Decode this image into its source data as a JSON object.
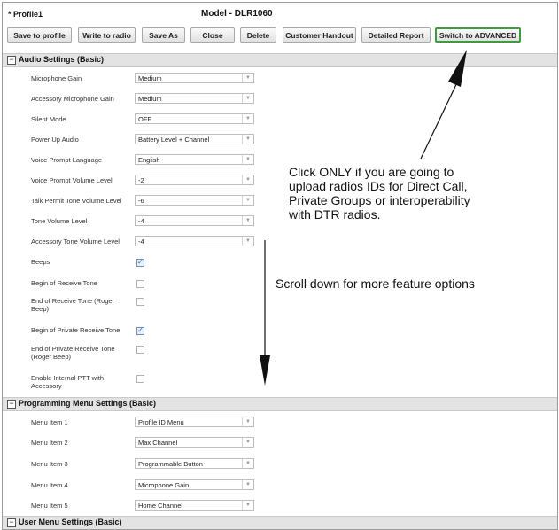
{
  "window": {
    "profile_title": "* Profile1",
    "model_title": "Model - DLR1060"
  },
  "toolbar": {
    "save_to_profile": "Save to profile",
    "write_to_radio": "Write to radio",
    "save_as": "Save As",
    "close": "Close",
    "delete": "Delete",
    "customer_handout": "Customer Handout",
    "detailed_report": "Detailed Report",
    "switch_advanced": "Switch to ADVANCED"
  },
  "audio": {
    "title": "Audio Settings (Basic)",
    "rows": [
      {
        "label": "Microphone Gain",
        "value": "Medium"
      },
      {
        "label": "Accessory Microphone Gain",
        "value": "Medium"
      },
      {
        "label": "Silent Mode",
        "value": "OFF"
      },
      {
        "label": "Power Up Audio",
        "value": "Battery Level + Channel"
      },
      {
        "label": "Voice Prompt Language",
        "value": "English"
      },
      {
        "label": "Voice Prompt Volume Level",
        "value": "-2"
      },
      {
        "label": "Talk Permit Tone Volume Level",
        "value": "-6"
      },
      {
        "label": "Tone Volume Level",
        "value": "-4"
      },
      {
        "label": "Accessory Tone Volume Level",
        "value": "-4"
      }
    ],
    "checks": [
      {
        "label": "Beeps",
        "checked": true
      },
      {
        "label": "Begin of Receive Tone",
        "checked": false
      },
      {
        "label": "End of Receive Tone (Roger Beep)",
        "checked": false
      },
      {
        "label": "Begin of Private Receive Tone",
        "checked": true
      },
      {
        "label": "End of Private Receive Tone (Roger Beep)",
        "checked": false
      },
      {
        "label": "Enable Internal PTT with Accessory",
        "checked": false
      }
    ]
  },
  "programming": {
    "title": "Programming Menu Settings (Basic)",
    "rows": [
      {
        "label": "Menu Item 1",
        "value": "Profile ID Menu"
      },
      {
        "label": "Menu Item 2",
        "value": "Max Channel"
      },
      {
        "label": "Menu Item 3",
        "value": "Programmable Button"
      },
      {
        "label": "Menu Item 4",
        "value": "Microphone Gain"
      },
      {
        "label": "Menu Item 5",
        "value": "Home Channel"
      }
    ]
  },
  "user_menu": {
    "title": "User Menu Settings (Basic)"
  },
  "annotations": {
    "advanced_note_lines": [
      "Click ONLY if you are going to",
      "upload radios IDs for Direct Call,",
      "Private Groups or interoperability",
      "with DTR radios."
    ],
    "scroll_note": "Scroll down for more feature options"
  },
  "icons": {
    "collapse": "collapse-minus-icon",
    "dropdown": "chevron-down-icon",
    "checkbox": "checkbox-icon",
    "arrow": "annotation-arrow-icon"
  },
  "colors": {
    "advanced_border": "#3f9a3f",
    "section_bg": "#e3e3e3",
    "checked_fill": "#e7f0fb"
  }
}
